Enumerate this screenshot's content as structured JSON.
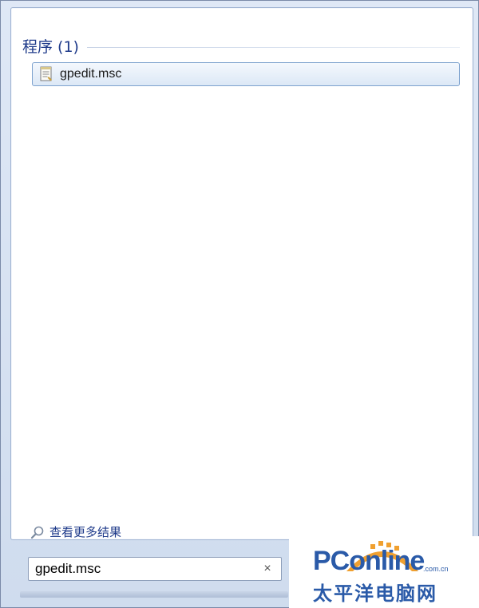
{
  "results": {
    "group_title": "程序 (1)",
    "items": [
      {
        "label": "gpedit.msc",
        "icon": "document-icon"
      }
    ]
  },
  "more_results": {
    "label": "查看更多结果",
    "icon": "magnifier-icon"
  },
  "search": {
    "value": "gpedit.msc",
    "clear_icon": "×"
  },
  "watermark": {
    "logo": "PConline",
    "domain": ".com.cn",
    "chinese": "太平洋电脑网"
  },
  "colors": {
    "accent": "#1e3a8a",
    "selection_border": "#7da2ce",
    "watermark": "#2a5aa8",
    "watermark_burst": "#f0a030"
  }
}
